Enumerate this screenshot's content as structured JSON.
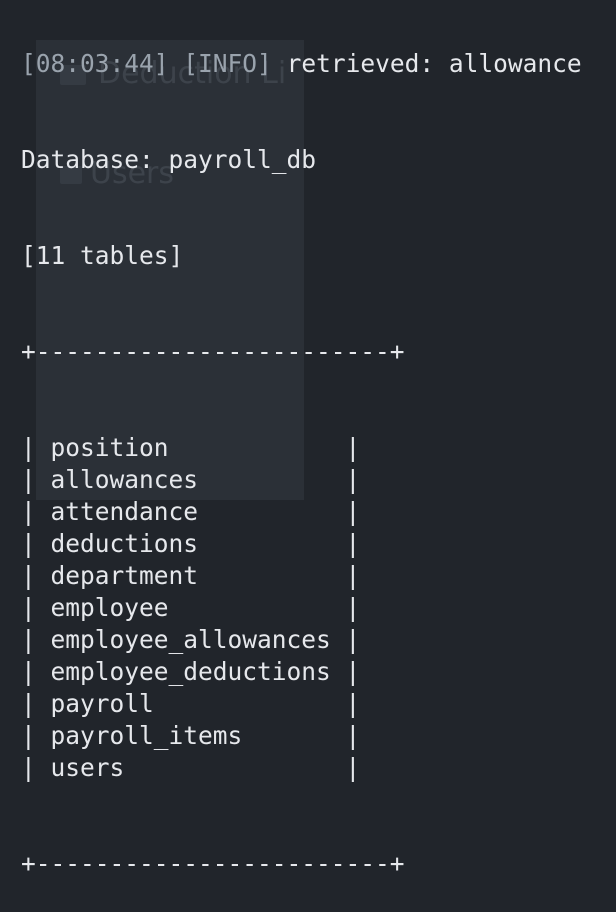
{
  "log": {
    "timestamp": "[08:03:44]",
    "level": "[INFO]",
    "message": "retrieved: allowance"
  },
  "database_line": "Database: payroll_db",
  "table_count_line": "[11 tables]",
  "table": {
    "top_border": "+------------------------+",
    "bottom_border": "+------------------------+",
    "rows": [
      {
        "name": "position"
      },
      {
        "name": "allowances"
      },
      {
        "name": "attendance"
      },
      {
        "name": "deductions"
      },
      {
        "name": "department"
      },
      {
        "name": "employee"
      },
      {
        "name": "employee_allowances"
      },
      {
        "name": "employee_deductions"
      },
      {
        "name": "payroll"
      },
      {
        "name": "payroll_items"
      },
      {
        "name": "users"
      }
    ],
    "row_width": 19,
    "left_edge": "| ",
    "right_edge": " |"
  },
  "background_window": {
    "title": "Deduction Li",
    "users_label": "Users"
  },
  "colors": {
    "terminal_bg": "#21252b",
    "text": "#e6e8ec",
    "background_window": "#2b3037"
  }
}
